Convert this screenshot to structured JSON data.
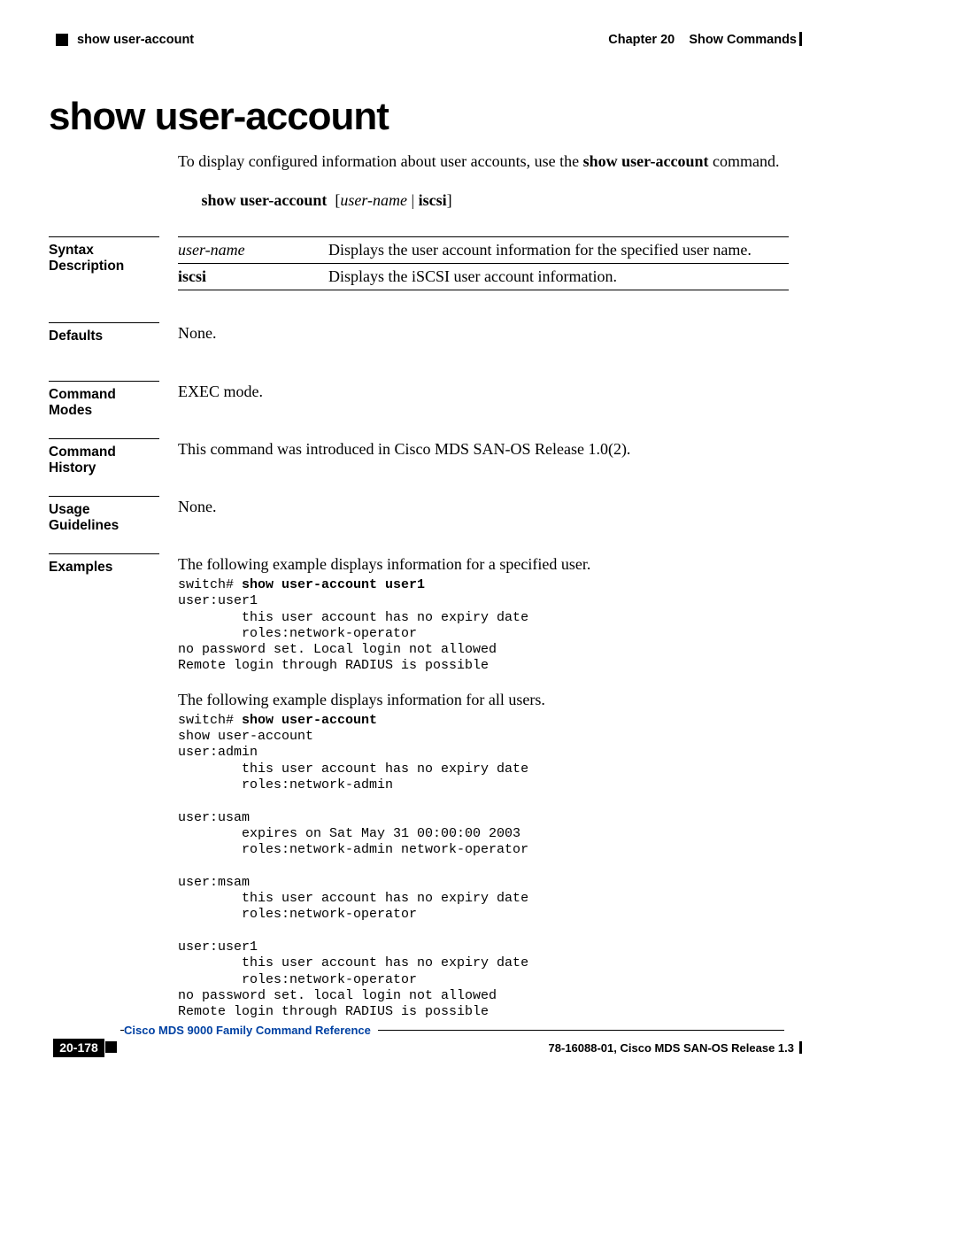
{
  "header": {
    "left_running": "show user-account",
    "right_chapter": "Chapter 20",
    "right_section": "Show Commands"
  },
  "title": "show user-account",
  "intro": {
    "pre": "To display configured information about user accounts, use the ",
    "bold": "show user-account",
    "post": " command."
  },
  "synopsis": {
    "cmd_bold": "show user-account",
    "arg_italic": "user-name",
    "opt_bold": "iscsi"
  },
  "sections": {
    "syntax_label": "Syntax Description",
    "defaults_label": "Defaults",
    "modes_label": "Command Modes",
    "history_label": "Command History",
    "usage_label": "Usage Guidelines",
    "examples_label": "Examples"
  },
  "syntax_table": [
    {
      "key_italic": "user-name",
      "key_bold": "",
      "desc": "Displays the user account information for the specified user name."
    },
    {
      "key_italic": "",
      "key_bold": "iscsi",
      "desc": "Displays the iSCSI user account information."
    }
  ],
  "defaults_value": "None.",
  "modes_value": "EXEC mode.",
  "history_value": "This command was introduced in Cisco MDS SAN-OS Release 1.0(2).",
  "usage_value": "None.",
  "examples": {
    "lead1": "The following example displays information for a specified user.",
    "cli1_prompt": "switch# ",
    "cli1_bold": "show user-account user1",
    "cli1_body": "user:user1\n        this user account has no expiry date\n        roles:network-operator\nno password set. Local login not allowed\nRemote login through RADIUS is possible",
    "lead2": "The following example displays information for all users.",
    "cli2_prompt": "switch# ",
    "cli2_bold": "show user-account",
    "cli2_body": "show user-account\nuser:admin\n        this user account has no expiry date\n        roles:network-admin\n\nuser:usam\n        expires on Sat May 31 00:00:00 2003\n        roles:network-admin network-operator\n\nuser:msam\n        this user account has no expiry date\n        roles:network-operator\n\nuser:user1\n        this user account has no expiry date\n        roles:network-operator\nno password set. local login not allowed\nRemote login through RADIUS is possible"
  },
  "footer": {
    "book_title": "Cisco MDS 9000 Family Command Reference",
    "page_number": "20-178",
    "doc_id": "78-16088-01, Cisco MDS SAN-OS Release 1.3"
  }
}
